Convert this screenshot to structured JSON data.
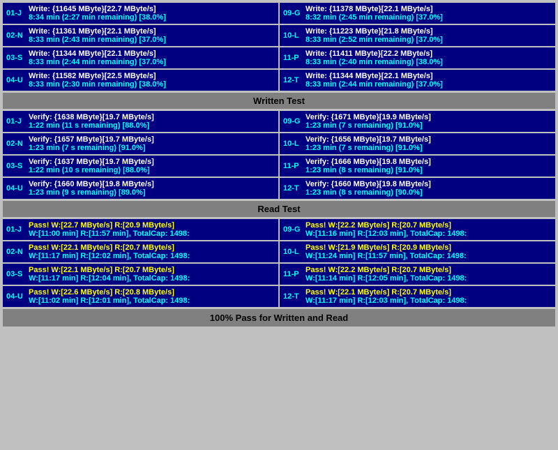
{
  "sections": {
    "write": {
      "header": "Written Test",
      "left": [
        {
          "id": "01-J",
          "line1": "Write: {11645 MByte}[22.7 MByte/s]",
          "line2": "8:34 min (2:27 min remaining)  [38.0%]"
        },
        {
          "id": "02-N",
          "line1": "Write: {11361 MByte}[22.1 MByte/s]",
          "line2": "8:33 min (2:43 min remaining)  [37.0%]"
        },
        {
          "id": "03-S",
          "line1": "Write: {11344 MByte}[22.1 MByte/s]",
          "line2": "8:33 min (2:44 min remaining)  [37.0%]"
        },
        {
          "id": "04-U",
          "line1": "Write: {11582 MByte}[22.5 MByte/s]",
          "line2": "8:33 min (2:30 min remaining)  [38.0%]"
        }
      ],
      "right": [
        {
          "id": "09-G",
          "line1": "Write: {11378 MByte}[22.1 MByte/s]",
          "line2": "8:32 min (2:45 min remaining)  [37.0%]"
        },
        {
          "id": "10-L",
          "line1": "Write: {11223 MByte}[21.8 MByte/s]",
          "line2": "8:33 min (2:52 min remaining)  [37.0%]"
        },
        {
          "id": "11-P",
          "line1": "Write: {11411 MByte}[22.2 MByte/s]",
          "line2": "8:33 min (2:40 min remaining)  [38.0%]"
        },
        {
          "id": "12-T",
          "line1": "Write: {11344 MByte}[22.1 MByte/s]",
          "line2": "8:33 min (2:44 min remaining)  [37.0%]"
        }
      ]
    },
    "verify": {
      "header": "Written Test",
      "left": [
        {
          "id": "01-J",
          "line1": "Verify: {1638 MByte}[19.7 MByte/s]",
          "line2": "1:22 min (11 s remaining)   [88.0%]"
        },
        {
          "id": "02-N",
          "line1": "Verify: {1657 MByte}[19.7 MByte/s]",
          "line2": "1:23 min (7 s remaining)   [91.0%]"
        },
        {
          "id": "03-S",
          "line1": "Verify: {1637 MByte}[19.7 MByte/s]",
          "line2": "1:22 min (10 s remaining)   [88.0%]"
        },
        {
          "id": "04-U",
          "line1": "Verify: {1660 MByte}[19.8 MByte/s]",
          "line2": "1:23 min (9 s remaining)   [89.0%]"
        }
      ],
      "right": [
        {
          "id": "09-G",
          "line1": "Verify: {1671 MByte}[19.9 MByte/s]",
          "line2": "1:23 min (7 s remaining)   [91.0%]"
        },
        {
          "id": "10-L",
          "line1": "Verify: {1656 MByte}[19.7 MByte/s]",
          "line2": "1:23 min (7 s remaining)   [91.0%]"
        },
        {
          "id": "11-P",
          "line1": "Verify: {1666 MByte}[19.8 MByte/s]",
          "line2": "1:23 min (8 s remaining)   [91.0%]"
        },
        {
          "id": "12-T",
          "line1": "Verify: {1660 MByte}[19.8 MByte/s]",
          "line2": "1:23 min (8 s remaining)   [90.0%]"
        }
      ]
    },
    "read": {
      "header": "Read Test",
      "left": [
        {
          "id": "01-J",
          "line1": "Pass! W:[22.7 MByte/s] R:[20.9 MByte/s]",
          "line2": "W:[11:00 min] R:[11:57 min], TotalCap: 1498:"
        },
        {
          "id": "02-N",
          "line1": "Pass! W:[22.1 MByte/s] R:[20.7 MByte/s]",
          "line2": "W:[11:17 min] R:[12:02 min], TotalCap: 1498:"
        },
        {
          "id": "03-S",
          "line1": "Pass! W:[22.1 MByte/s] R:[20.7 MByte/s]",
          "line2": "W:[11:17 min] R:[12:04 min], TotalCap: 1498:"
        },
        {
          "id": "04-U",
          "line1": "Pass! W:[22.6 MByte/s] R:[20.8 MByte/s]",
          "line2": "W:[11:02 min] R:[12:01 min], TotalCap: 1498:"
        }
      ],
      "right": [
        {
          "id": "09-G",
          "line1": "Pass! W:[22.2 MByte/s] R:[20.7 MByte/s]",
          "line2": "W:[11:16 min] R:[12:03 min], TotalCap: 1498:"
        },
        {
          "id": "10-L",
          "line1": "Pass! W:[21.9 MByte/s] R:[20.9 MByte/s]",
          "line2": "W:[11:24 min] R:[11:57 min], TotalCap: 1498:"
        },
        {
          "id": "11-P",
          "line1": "Pass! W:[22.2 MByte/s] R:[20.7 MByte/s]",
          "line2": "W:[11:14 min] R:[12:05 min], TotalCap: 1498:"
        },
        {
          "id": "12-T",
          "line1": "Pass! W:[22.1 MByte/s] R:[20.7 MByte/s]",
          "line2": "W:[11:17 min] R:[12:03 min], TotalCap: 1498:"
        }
      ]
    }
  },
  "labels": {
    "written_test": "Written Test",
    "read_test": "Read Test",
    "footer": "100% Pass for Written and Read"
  }
}
